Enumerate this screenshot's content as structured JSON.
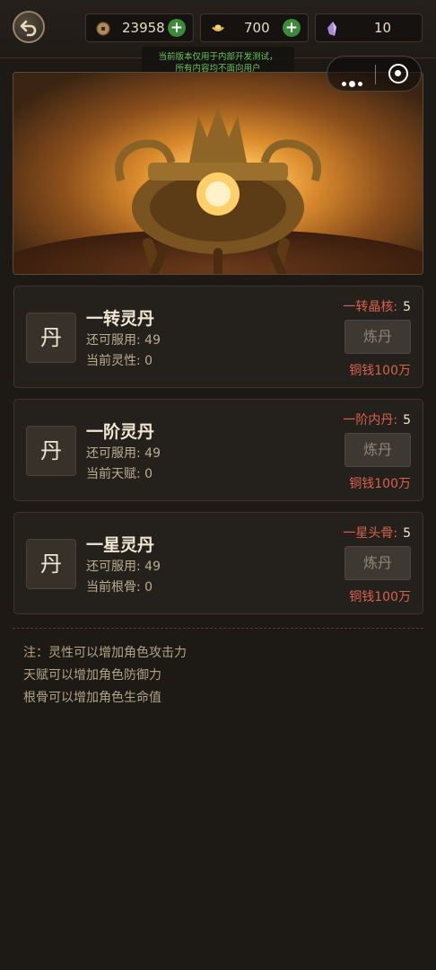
{
  "header": {
    "copper": "23958",
    "gold": "700",
    "crystal": "10",
    "test_notice_line1": "当前版本仅用于内部开发测试，",
    "test_notice_line2": "所有内容均不面向用户"
  },
  "cards": [
    {
      "icon_char": "丹",
      "title": "一转灵丹",
      "remaining_label": "还可服用:",
      "remaining": "49",
      "stat_label": "当前灵性:",
      "stat_value": "0",
      "req_label": "一转晶核:",
      "req_count": "5",
      "button": "炼丹",
      "cost": "铜钱100万"
    },
    {
      "icon_char": "丹",
      "title": "一阶灵丹",
      "remaining_label": "还可服用:",
      "remaining": "49",
      "stat_label": "当前天赋:",
      "stat_value": "0",
      "req_label": "一阶内丹:",
      "req_count": "5",
      "button": "炼丹",
      "cost": "铜钱100万"
    },
    {
      "icon_char": "丹",
      "title": "一星灵丹",
      "remaining_label": "还可服用:",
      "remaining": "49",
      "stat_label": "当前根骨:",
      "stat_value": "0",
      "req_label": "一星头骨:",
      "req_count": "5",
      "button": "炼丹",
      "cost": "铜钱100万"
    }
  ],
  "notes": [
    "注：灵性可以增加角色攻击力",
    "天赋可以增加角色防御力",
    "根骨可以增加角色生命值"
  ],
  "colors": {
    "accent_red": "#d8614f",
    "plus_green": "#3c8a3a",
    "notice_green": "#6bc55b"
  },
  "icons": [
    "back-arrow-icon",
    "copper-coin-icon",
    "gold-ingot-icon",
    "purple-crystal-icon",
    "plus-icon",
    "more-dots-icon",
    "record-target-icon"
  ]
}
